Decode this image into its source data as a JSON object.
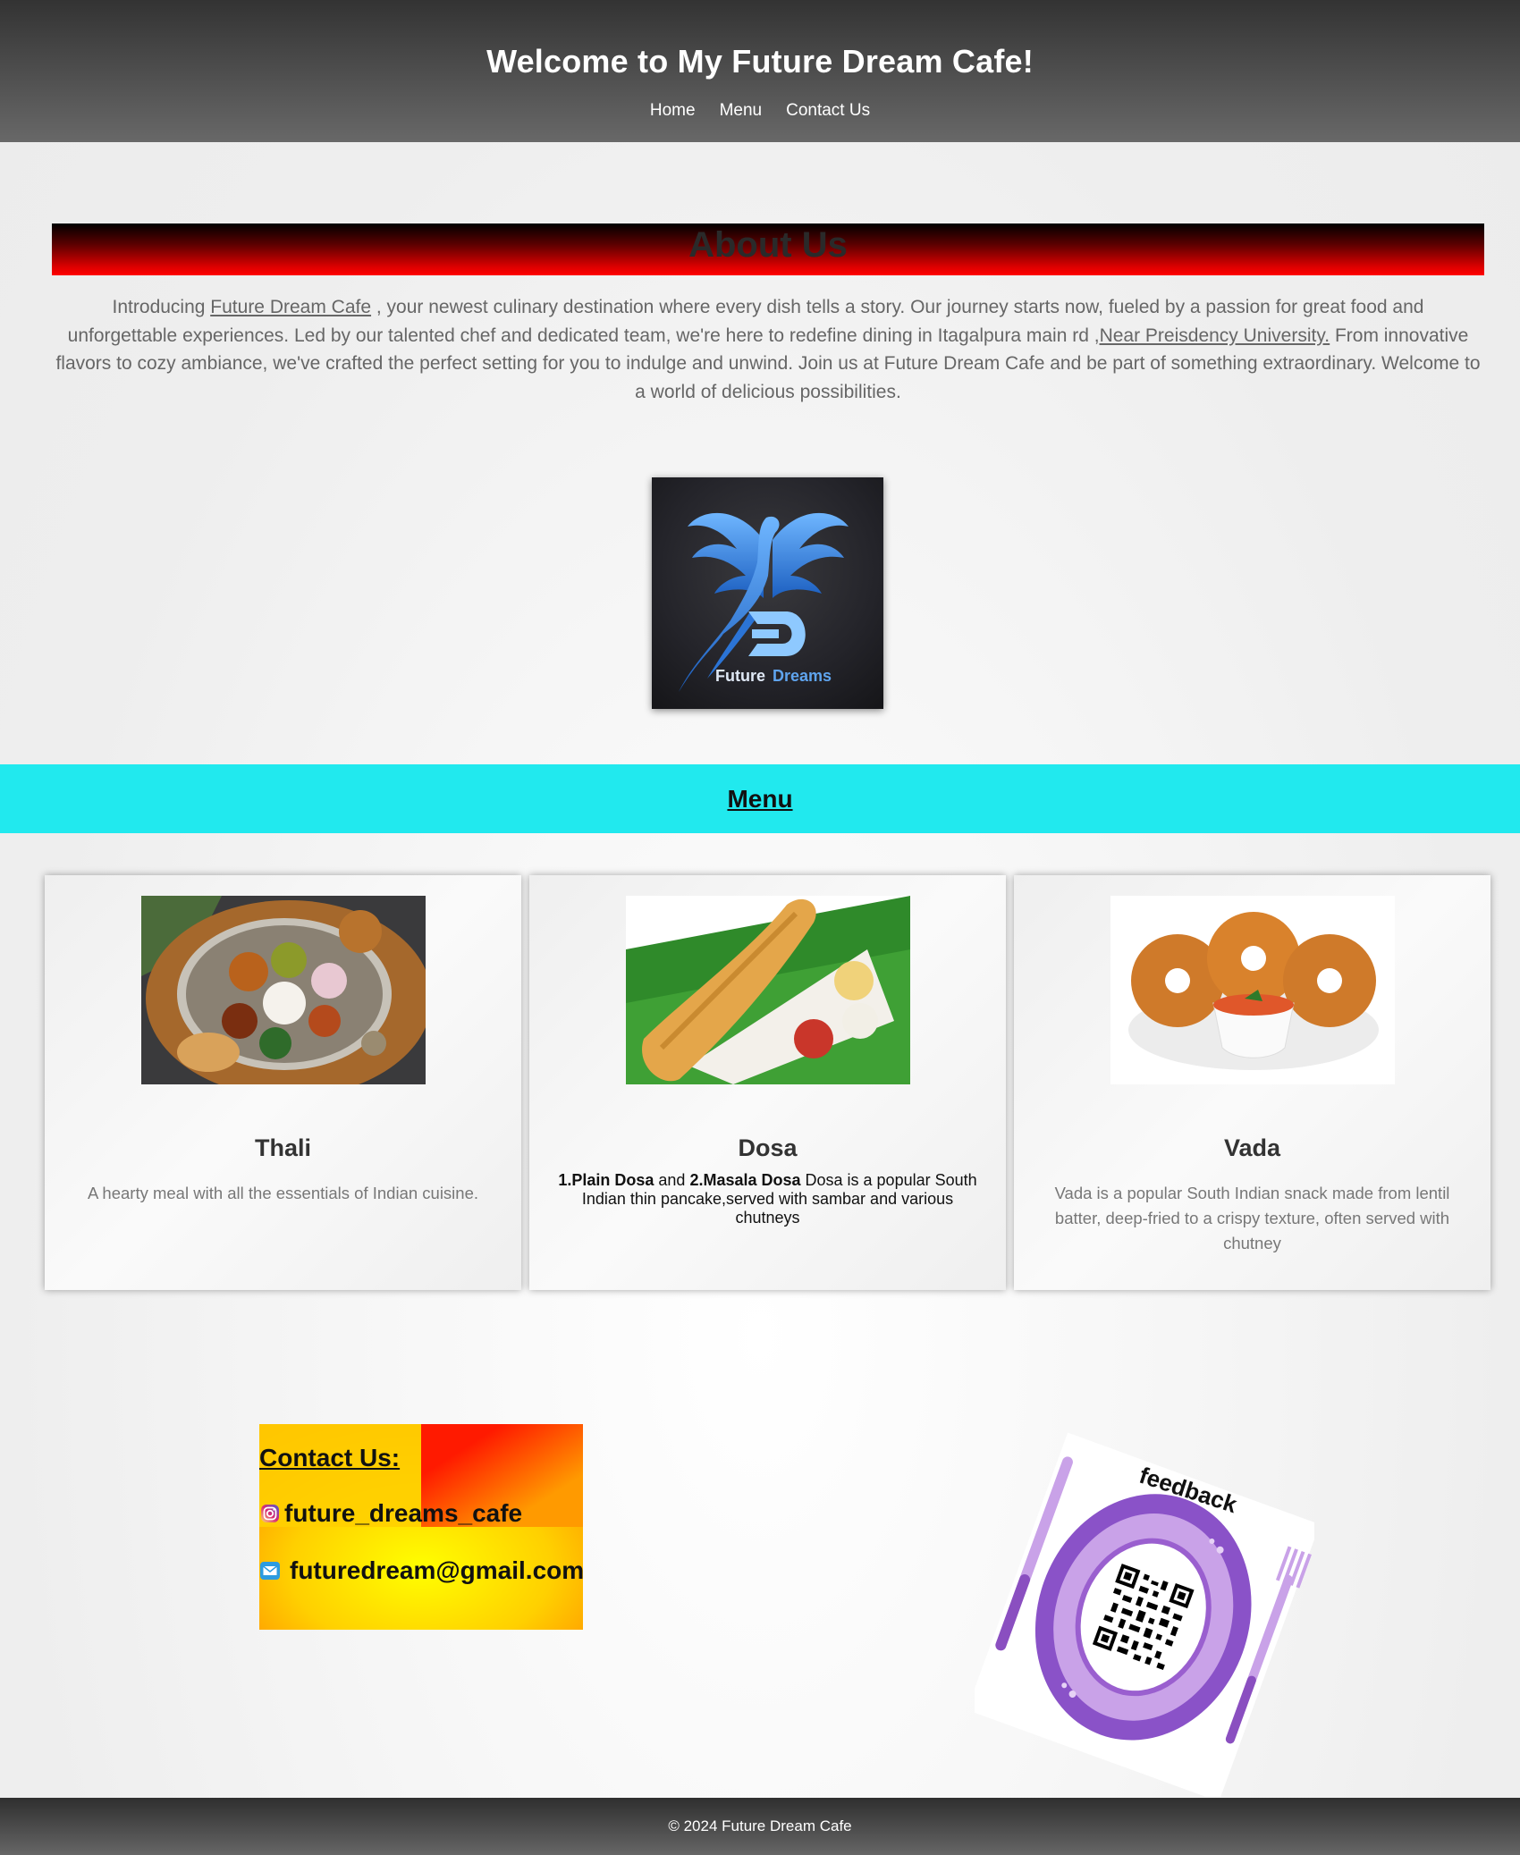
{
  "header": {
    "title": "Welcome to My Future Dream Cafe!",
    "nav": [
      {
        "label": "Home"
      },
      {
        "label": "Menu"
      },
      {
        "label": "Contact Us"
      }
    ]
  },
  "about": {
    "heading": "About Us",
    "text_1": "Introducing ",
    "link_cafe": "Future Dream Cafe",
    "text_2": " , your newest culinary destination where every dish tells a story. Our journey starts now, fueled by a passion for great food and unforgettable experiences. Led by our talented chef and dedicated team, we're here to redefine dining in Itagalpura main rd ,",
    "link_university": "Near Preisdency University.",
    "text_3": " From innovative flavors to cozy ambiance, we've crafted the perfect setting for you to indulge and unwind. Join us at Future Dream Cafe and be part of something extraordinary. Welcome to a world of delicious possibilities.",
    "logo_text_a": "Future",
    "logo_text_b": "Dreams"
  },
  "menu": {
    "heading": "Menu",
    "items": [
      {
        "name": "Thali",
        "description": "A hearty meal with all the essentials of Indian cuisine."
      },
      {
        "name": "Dosa",
        "bold_1": "1.Plain Dosa",
        "text_and": " and ",
        "bold_2": "2.Masala Dosa",
        "description": " Dosa is a popular South Indian thin pancake,served with sambar and various chutneys"
      },
      {
        "name": "Vada",
        "description": "Vada is a popular South Indian snack made from lentil batter, deep-fried to a crispy texture, often served with chutney"
      }
    ]
  },
  "contact": {
    "heading": "Contact Us:",
    "instagram": "future_dreams_cafe",
    "email": "futuredream@gmail.com"
  },
  "feedback": {
    "label": "feedback"
  },
  "footer": {
    "text": "© 2024 Future Dream Cafe"
  },
  "colors": {
    "header_bg": "#333333",
    "about_banner": "#ff0000",
    "menu_banner": "#21e9ee",
    "plate_purple": "#9a5fcf"
  }
}
